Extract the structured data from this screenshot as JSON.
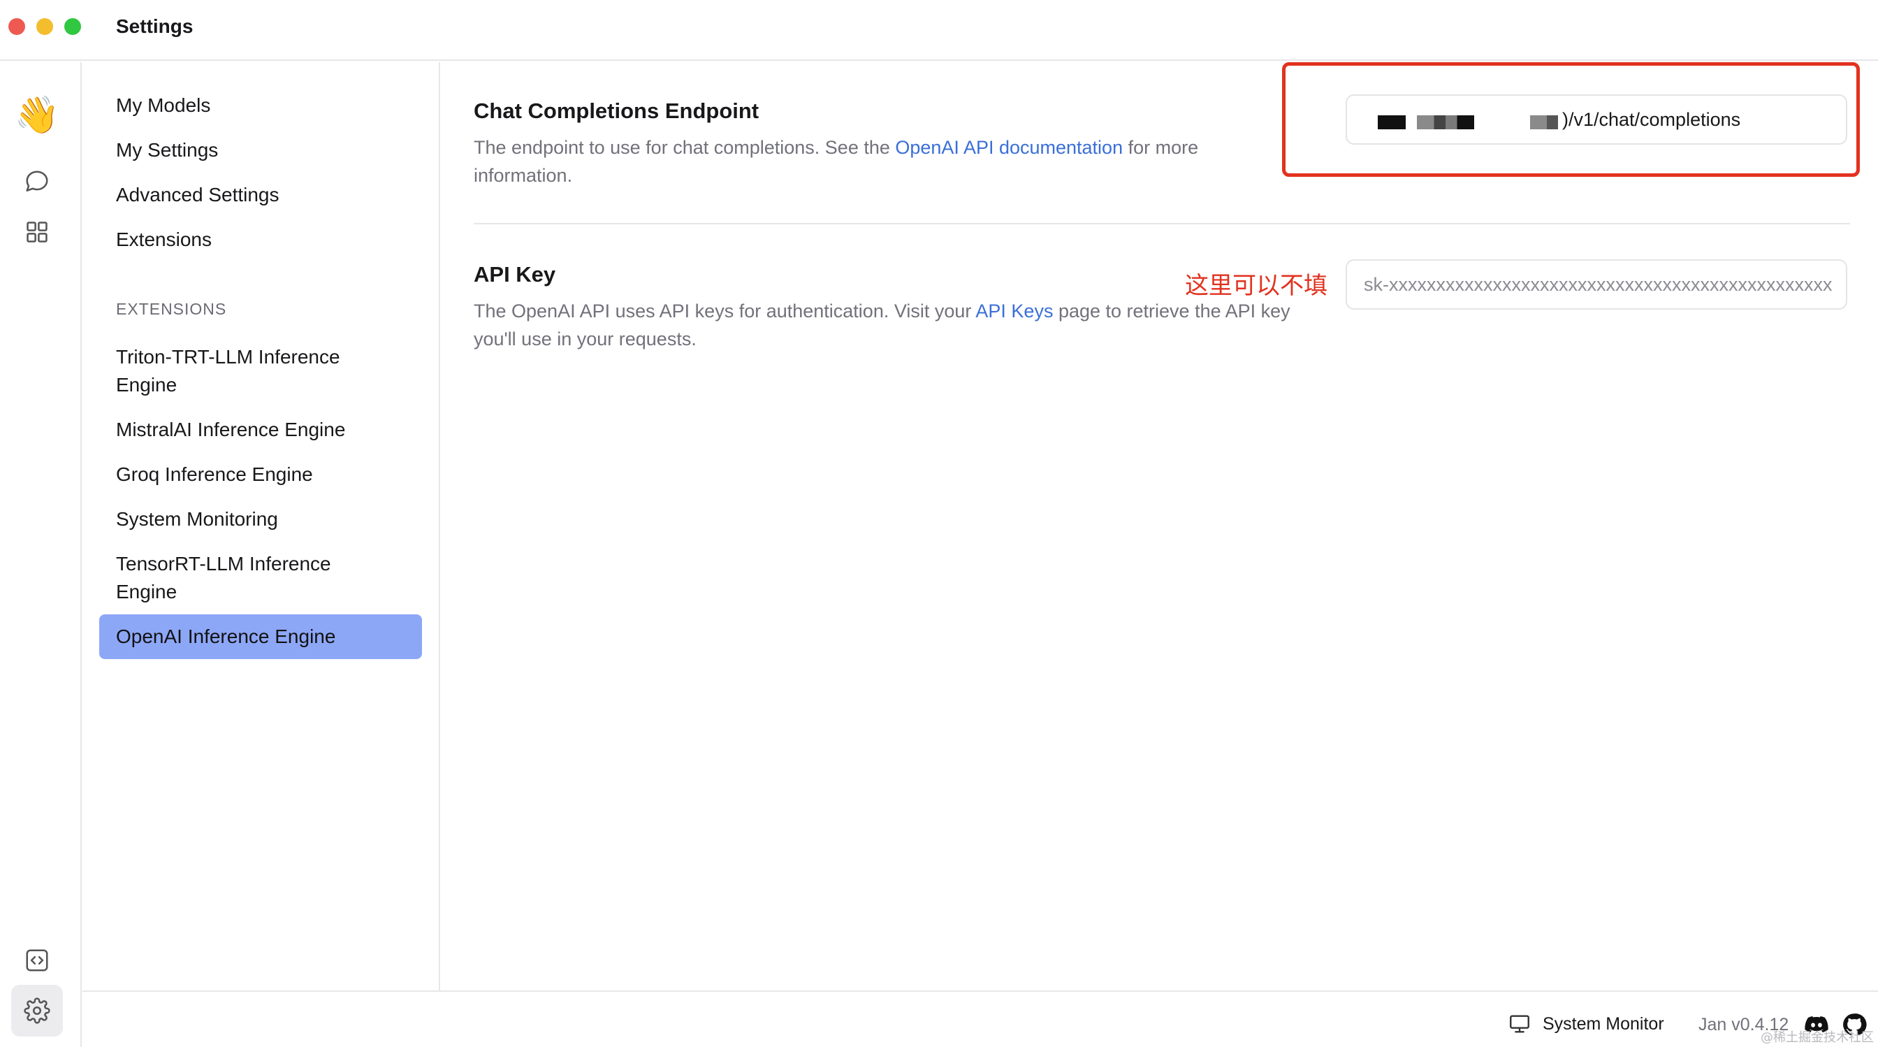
{
  "window": {
    "title": "Settings"
  },
  "sidebar": {
    "items": [
      {
        "label": "My Models"
      },
      {
        "label": "My Settings"
      },
      {
        "label": "Advanced Settings"
      },
      {
        "label": "Extensions"
      }
    ],
    "extensions_label": "EXTENSIONS",
    "extensions": [
      {
        "label": "Triton-TRT-LLM Inference Engine"
      },
      {
        "label": "MistralAI Inference Engine"
      },
      {
        "label": "Groq Inference Engine"
      },
      {
        "label": "System Monitoring"
      },
      {
        "label": "TensorRT-LLM Inference Engine"
      },
      {
        "label": "OpenAI Inference Engine"
      }
    ],
    "active": "OpenAI Inference Engine"
  },
  "endpoint": {
    "title": "Chat Completions Endpoint",
    "desc_before": "The endpoint to use for chat completions. See the ",
    "desc_link": "OpenAI API documentation",
    "desc_after": " for more information.",
    "value_suffix": ")/v1/chat/completions"
  },
  "apikey": {
    "title": "API Key",
    "desc_before": "The OpenAI API uses API keys for authentication. Visit your ",
    "desc_link": "API Keys",
    "desc_after": " page to retrieve the API key you'll use in your requests.",
    "placeholder": "sk-xxxxxxxxxxxxxxxxxxxxxxxxxxxxxxxxxxxxxxxxxxxxxxx"
  },
  "annotation": "这里可以不填",
  "statusbar": {
    "system_monitor": "System Monitor",
    "version": "Jan v0.4.12"
  },
  "watermark": "@稀土掘金技术社区",
  "colors": {
    "accent": "#8da7f7",
    "link": "#3a6fd8",
    "annotation": "#e2321f"
  },
  "icons": [
    "wave-icon",
    "chat-icon",
    "grid-icon",
    "code-icon",
    "gear-icon",
    "monitor-icon",
    "discord-icon",
    "github-icon"
  ]
}
